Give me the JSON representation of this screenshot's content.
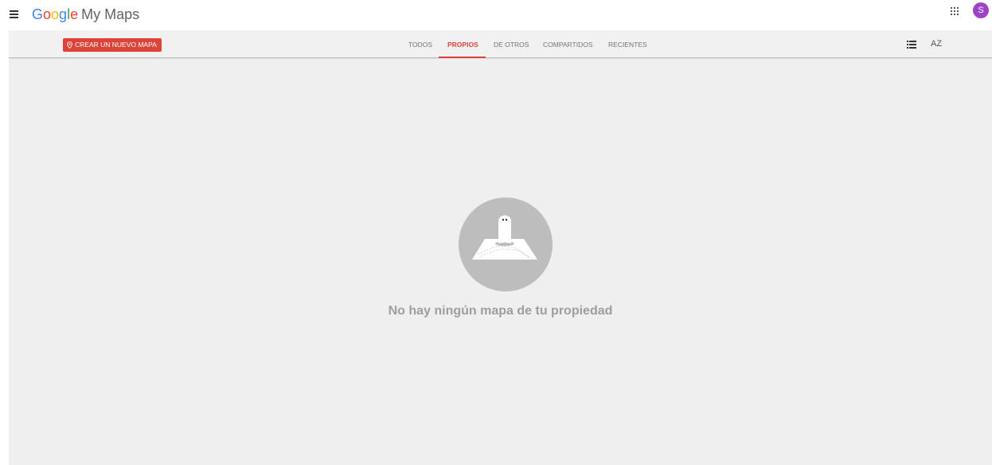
{
  "header": {
    "logo_letters": [
      "G",
      "o",
      "o",
      "g",
      "l",
      "e"
    ],
    "product_name": "My Maps",
    "user_initial": "S"
  },
  "toolbar": {
    "create_label": "CREAR UN NUEVO MAPA",
    "tabs": [
      {
        "label": "TODOS",
        "active": false
      },
      {
        "label": "PROPIOS",
        "active": true
      },
      {
        "label": "DE OTROS",
        "active": false
      },
      {
        "label": "COMPARTIDOS",
        "active": false
      },
      {
        "label": "RECIENTES",
        "active": false
      }
    ],
    "sort_label": "AZ"
  },
  "empty_state": {
    "message": "No hay ningún mapa de tu propiedad"
  },
  "colors": {
    "accent": "#db4437",
    "avatar": "#9c44c8",
    "background": "#efefef",
    "empty_circle": "#bdbdbd"
  },
  "icons": {
    "menu": "hamburger-menu-icon",
    "apps": "apps-grid-icon",
    "create": "map-pin-icon",
    "list_view": "list-view-icon",
    "sort": "sort-az-icon",
    "empty": "map-ghost-illustration"
  }
}
